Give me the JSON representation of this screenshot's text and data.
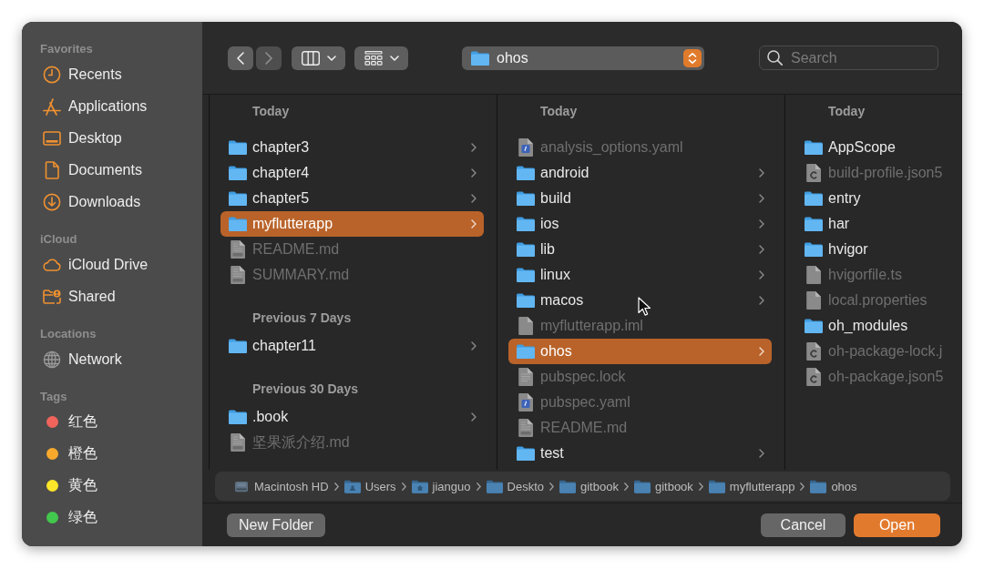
{
  "sidebar": {
    "sections": [
      {
        "title": "Favorites",
        "items": [
          {
            "label": "Recents",
            "kind": "recents",
            "selected": false
          },
          {
            "label": "Applications",
            "kind": "applications",
            "selected": false
          },
          {
            "label": "Desktop",
            "kind": "desktop",
            "selected": false
          },
          {
            "label": "Documents",
            "kind": "documents",
            "selected": false
          },
          {
            "label": "Downloads",
            "kind": "downloads",
            "selected": false
          }
        ]
      },
      {
        "title": "iCloud",
        "items": [
          {
            "label": "iCloud Drive",
            "kind": "cloud",
            "selected": false
          },
          {
            "label": "Shared",
            "kind": "shared",
            "selected": false
          }
        ]
      },
      {
        "title": "Locations",
        "items": [
          {
            "label": "Network",
            "kind": "network",
            "selected": false
          }
        ]
      },
      {
        "title": "Tags",
        "items": [
          {
            "label": "红色",
            "kind": "tag",
            "color": "#f0645c",
            "selected": false
          },
          {
            "label": "橙色",
            "kind": "tag",
            "color": "#f8a92c",
            "selected": false
          },
          {
            "label": "黄色",
            "kind": "tag",
            "color": "#fbe62a",
            "selected": false
          },
          {
            "label": "绿色",
            "kind": "tag",
            "color": "#43c84e",
            "selected": false
          }
        ]
      }
    ]
  },
  "toolbar": {
    "nav_buttons": [
      {
        "kind": "back",
        "disabled": false
      },
      {
        "kind": "forward",
        "disabled": true
      }
    ],
    "view_buttons": [
      {
        "kind": "columns"
      },
      {
        "kind": "grid"
      }
    ],
    "location": {
      "label": "ohos"
    },
    "search": {
      "placeholder": "Search"
    }
  },
  "columns": [
    {
      "groups": [
        {
          "title": "Today",
          "items": [
            {
              "name": "chapter3",
              "kind": "folder",
              "selected": false,
              "disabled": false,
              "arrow": true
            },
            {
              "name": "chapter4",
              "kind": "folder",
              "selected": false,
              "disabled": false,
              "arrow": true
            },
            {
              "name": "chapter5",
              "kind": "folder",
              "selected": false,
              "disabled": false,
              "arrow": true
            },
            {
              "name": "myflutterapp",
              "kind": "folder",
              "selected": true,
              "disabled": false,
              "arrow": true
            },
            {
              "name": "README.md",
              "kind": "markdown",
              "selected": false,
              "disabled": true,
              "arrow": false
            },
            {
              "name": "SUMMARY.md",
              "kind": "markdown",
              "selected": false,
              "disabled": true,
              "arrow": false
            }
          ]
        },
        {
          "title": "Previous 7 Days",
          "items": [
            {
              "name": "chapter11",
              "kind": "folder",
              "selected": false,
              "disabled": false,
              "arrow": true
            }
          ]
        },
        {
          "title": "Previous 30 Days",
          "items": [
            {
              "name": ".book",
              "kind": "folder",
              "selected": false,
              "disabled": false,
              "arrow": true
            },
            {
              "name": "坚果派介绍.md",
              "kind": "markdown",
              "selected": false,
              "disabled": true,
              "arrow": false
            }
          ]
        }
      ]
    },
    {
      "groups": [
        {
          "title": "Today",
          "items": [
            {
              "name": "analysis_options.yaml",
              "kind": "yaml",
              "selected": false,
              "disabled": true,
              "arrow": false
            },
            {
              "name": "android",
              "kind": "folder",
              "selected": false,
              "disabled": false,
              "arrow": true
            },
            {
              "name": "build",
              "kind": "folder",
              "selected": false,
              "disabled": false,
              "arrow": true
            },
            {
              "name": "ios",
              "kind": "folder",
              "selected": false,
              "disabled": false,
              "arrow": true
            },
            {
              "name": "lib",
              "kind": "folder",
              "selected": false,
              "disabled": false,
              "arrow": true
            },
            {
              "name": "linux",
              "kind": "folder",
              "selected": false,
              "disabled": false,
              "arrow": true
            },
            {
              "name": "macos",
              "kind": "folder",
              "selected": false,
              "disabled": false,
              "arrow": true
            },
            {
              "name": "myflutterapp.iml",
              "kind": "plain",
              "selected": false,
              "disabled": true,
              "arrow": false
            },
            {
              "name": "ohos",
              "kind": "folder",
              "selected": true,
              "disabled": false,
              "arrow": true
            },
            {
              "name": "pubspec.lock",
              "kind": "text",
              "selected": false,
              "disabled": true,
              "arrow": false
            },
            {
              "name": "pubspec.yaml",
              "kind": "yaml",
              "selected": false,
              "disabled": true,
              "arrow": false
            },
            {
              "name": "README.md",
              "kind": "markdown",
              "selected": false,
              "disabled": true,
              "arrow": false
            },
            {
              "name": "test",
              "kind": "folder",
              "selected": false,
              "disabled": false,
              "arrow": true
            }
          ]
        }
      ]
    },
    {
      "groups": [
        {
          "title": "Today",
          "items": [
            {
              "name": "AppScope",
              "kind": "folder",
              "selected": false,
              "disabled": false,
              "arrow": false
            },
            {
              "name": "build-profile.json5",
              "kind": "config",
              "selected": false,
              "disabled": true,
              "arrow": false
            },
            {
              "name": "entry",
              "kind": "folder",
              "selected": false,
              "disabled": false,
              "arrow": false
            },
            {
              "name": "har",
              "kind": "folder",
              "selected": false,
              "disabled": false,
              "arrow": false
            },
            {
              "name": "hvigor",
              "kind": "folder",
              "selected": false,
              "disabled": false,
              "arrow": false
            },
            {
              "name": "hvigorfile.ts",
              "kind": "plain",
              "selected": false,
              "disabled": true,
              "arrow": false
            },
            {
              "name": "local.properties",
              "kind": "plain",
              "selected": false,
              "disabled": true,
              "arrow": false
            },
            {
              "name": "oh_modules",
              "kind": "folder",
              "selected": false,
              "disabled": false,
              "arrow": false
            },
            {
              "name": "oh-package-lock.j",
              "kind": "config",
              "selected": false,
              "disabled": true,
              "arrow": false
            },
            {
              "name": "oh-package.json5",
              "kind": "config",
              "selected": false,
              "disabled": true,
              "arrow": false
            }
          ]
        }
      ]
    }
  ],
  "path_bar": [
    {
      "label": "Macintosh HD",
      "kind": "disk"
    },
    {
      "label": "Users",
      "kind": "users"
    },
    {
      "label": "jianguo",
      "kind": "home"
    },
    {
      "label": "Deskto",
      "kind": "folder"
    },
    {
      "label": "gitbook",
      "kind": "folder"
    },
    {
      "label": "gitbook",
      "kind": "folder"
    },
    {
      "label": "myflutterapp",
      "kind": "folder"
    },
    {
      "label": "ohos",
      "kind": "folder"
    }
  ],
  "buttons": [
    {
      "label": "New Folder",
      "kind": "secondary"
    },
    {
      "label": "Cancel",
      "kind": "secondary"
    },
    {
      "label": "Open",
      "kind": "primary"
    }
  ]
}
